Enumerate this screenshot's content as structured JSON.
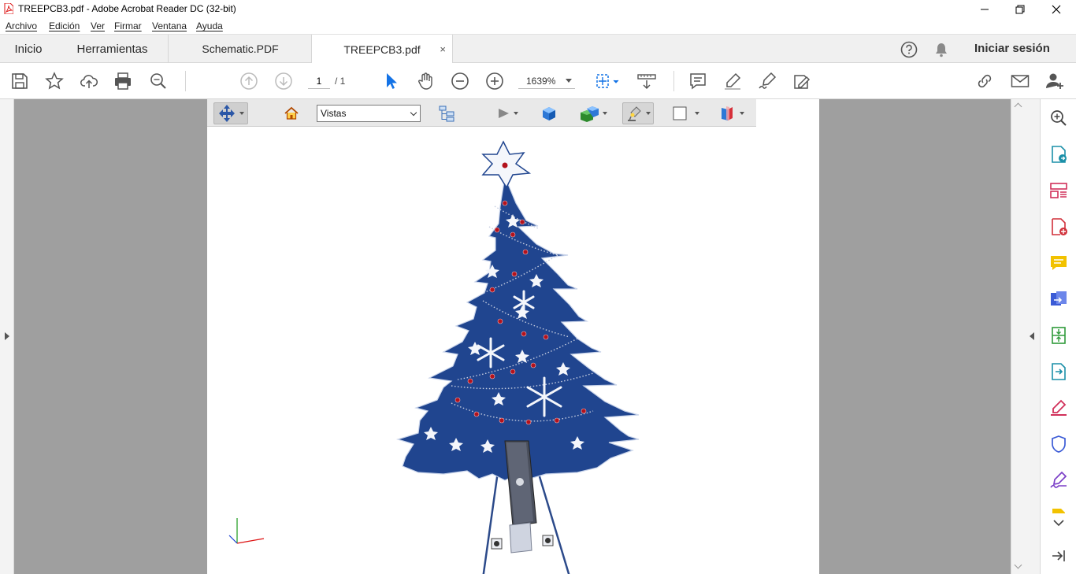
{
  "window": {
    "title": "TREEPCB3.pdf - Adobe Acrobat Reader DC (32-bit)"
  },
  "menu": [
    "Archivo",
    "Edición",
    "Ver",
    "Firmar",
    "Ventana",
    "Ayuda"
  ],
  "tabs": {
    "home": "Inicio",
    "tools": "Herramientas",
    "doc1": "Schematic.PDF",
    "doc2": "TREEPCB3.pdf",
    "close": "×"
  },
  "header": {
    "signin": "Iniciar sesión"
  },
  "toolbar": {
    "page_current": "1",
    "page_total": "/ 1",
    "zoom": "1639%"
  },
  "toolbar3d": {
    "views_label": "Vistas"
  },
  "icons": {
    "toolbar": [
      "save-icon",
      "bookmark-star-icon",
      "upload-cloud-icon",
      "print-icon",
      "zoom-search-icon",
      "page-up-icon",
      "page-down-icon",
      "select-cursor-icon",
      "hand-pan-icon",
      "zoom-out-icon",
      "zoom-in-icon",
      "fit-page-icon",
      "read-mode-icon",
      "comment-icon",
      "highlight-pen-icon",
      "sign-icon",
      "edit-redact-icon",
      "share-link-icon",
      "email-icon",
      "add-user-icon"
    ],
    "right_panel": [
      "search-zoom-icon",
      "export-pdf-icon",
      "organize-pages-icon",
      "create-pdf-icon",
      "comment-tool-icon",
      "combine-files-icon",
      "compress-icon",
      "export-convert-icon",
      "fill-sign-icon",
      "protect-shield-icon",
      "certificate-sign-icon",
      "more-tools-icon",
      "expand-down-icon",
      "collapse-panel-icon"
    ]
  },
  "colors": {
    "tree_blue": "#20458f",
    "accent_blue": "#1473e6",
    "bead_red": "#b3121c"
  }
}
